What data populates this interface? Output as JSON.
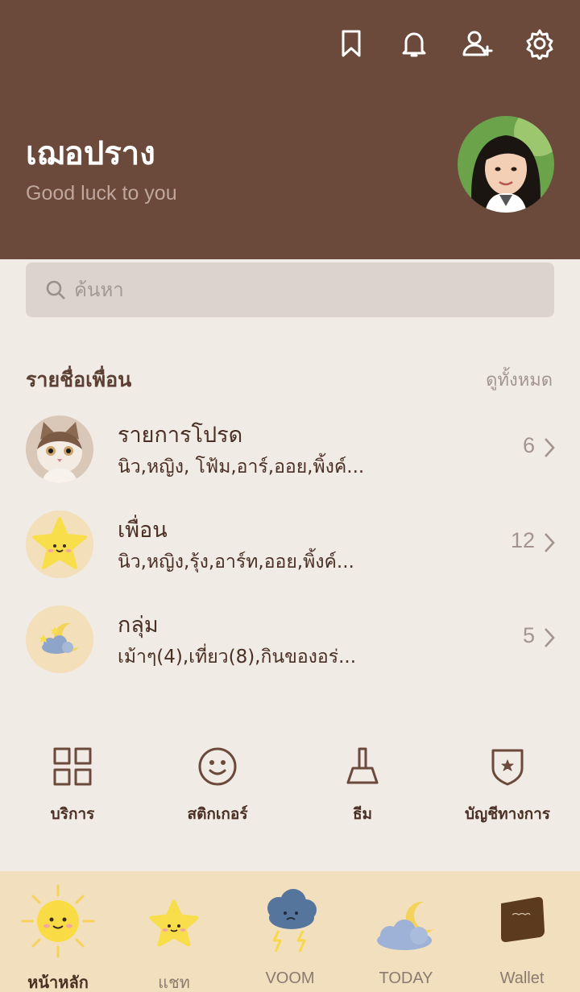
{
  "header": {
    "name": "เฌอปราง",
    "status": "Good luck to you",
    "icons": [
      "bookmark-icon",
      "bell-icon",
      "add-friend-icon",
      "gear-icon"
    ]
  },
  "search": {
    "placeholder": "ค้นหา"
  },
  "friends_section": {
    "title": "รายชื่อเพื่อน",
    "see_all": "ดูทั้งหมด",
    "rows": [
      {
        "title": "รายการโปรด",
        "sub": "นิว,หญิง, โฟ้ม,อาร์,ออย,พิ้งค์...",
        "count": "6"
      },
      {
        "title": "เพื่อน",
        "sub": "นิว,หญิง,รุ้ง,อาร์ท,ออย,พิ้งค์...",
        "count": "12"
      },
      {
        "title": "กลุ่ม",
        "sub": "เม้าๆ(4),เที่ยว(8),กินของอร่...",
        "count": "5"
      }
    ]
  },
  "services": [
    {
      "label": "บริการ",
      "icon": "grid-icon"
    },
    {
      "label": "สติกเกอร์",
      "icon": "smiley-icon"
    },
    {
      "label": "ธีม",
      "icon": "brush-icon"
    },
    {
      "label": "บัญชีทางการ",
      "icon": "shield-star-icon"
    }
  ],
  "tabs": [
    {
      "label": "หน้าหลัก",
      "icon": "sun-icon",
      "active": true
    },
    {
      "label": "แชท",
      "icon": "star-icon",
      "active": false
    },
    {
      "label": "VOOM",
      "icon": "cloud-icon",
      "active": false
    },
    {
      "label": "TODAY",
      "icon": "moon-icon",
      "active": false
    },
    {
      "label": "Wallet",
      "icon": "wallet-icon",
      "active": false
    }
  ],
  "colors": {
    "header_bg": "#6b4a3c",
    "page_bg": "#f1ebe6",
    "tabbar_bg": "#f2dfbd",
    "accent": "#5b3f33"
  }
}
